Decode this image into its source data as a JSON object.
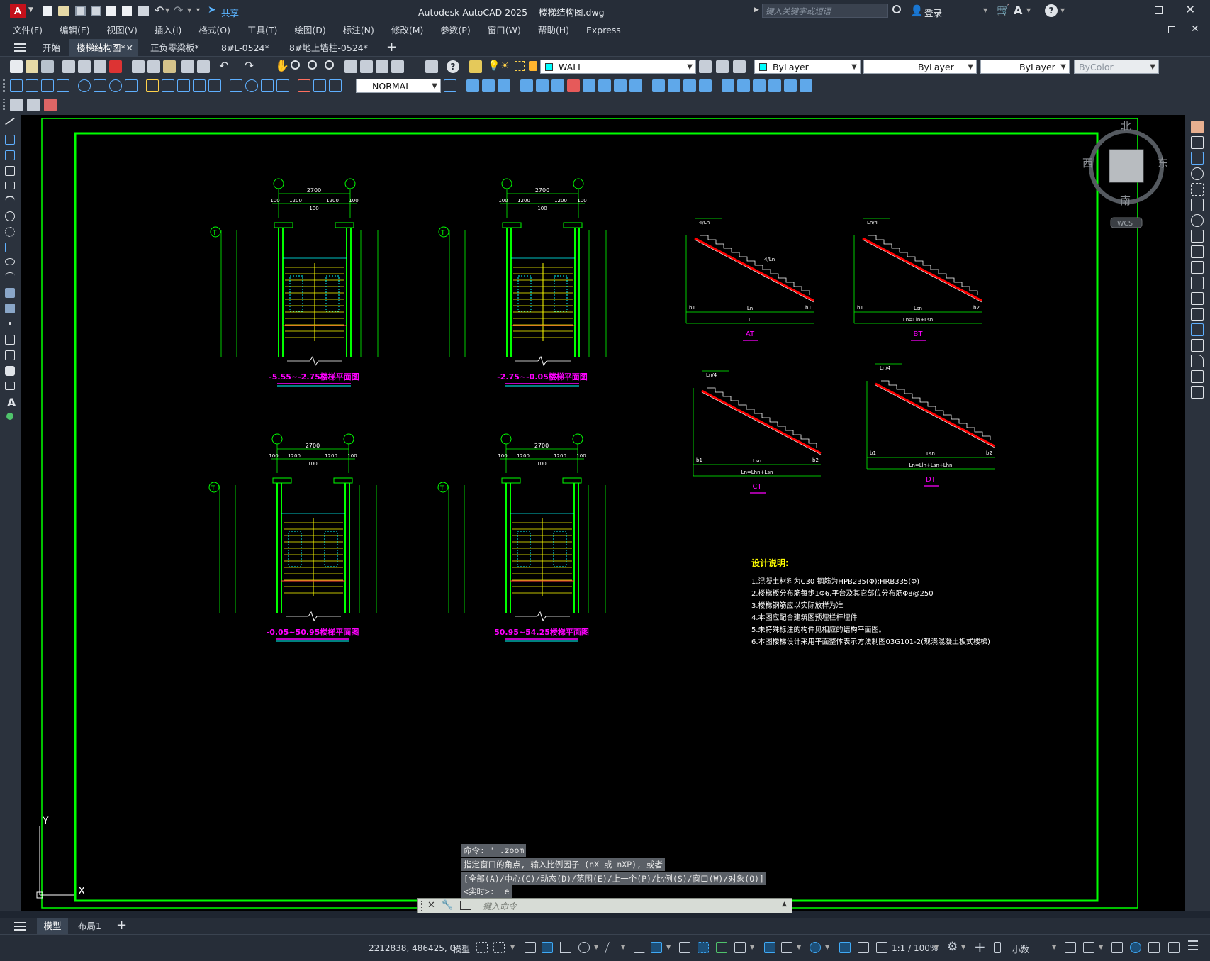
{
  "app": {
    "title": "Autodesk AutoCAD 2025    楼梯结构图.dwg",
    "share_label": "共享",
    "search_placeholder": "键入关键字或短语",
    "login_label": "登录"
  },
  "menu": [
    "文件(F)",
    "编辑(E)",
    "视图(V)",
    "插入(I)",
    "格式(O)",
    "工具(T)",
    "绘图(D)",
    "标注(N)",
    "修改(M)",
    "参数(P)",
    "窗口(W)",
    "帮助(H)",
    "Express"
  ],
  "file_tabs": [
    {
      "label": "开始"
    },
    {
      "label": "楼梯结构图*"
    },
    {
      "label": "正负零梁板*"
    },
    {
      "label": "8#L-0524*"
    },
    {
      "label": "8#地上墙柱-0524*"
    }
  ],
  "toolbar": {
    "layer_name": "WALL",
    "color": "ByLayer",
    "linetype": "ByLayer",
    "lineweight": "ByLayer",
    "plotstyle": "ByColor",
    "dimstyle": "NORMAL"
  },
  "viewcube": {
    "north": "北",
    "south": "南",
    "east": "东",
    "west": "西",
    "wcs": "WCS"
  },
  "ucs": {
    "y": "Y",
    "x": "X"
  },
  "drawing": {
    "plans": [
      {
        "title": "-5.55~-2.75楼梯平面图"
      },
      {
        "title": "-2.75~-0.05楼梯平面图"
      },
      {
        "title": "-0.05~50.95楼梯平面图"
      },
      {
        "title": "50.95~54.25楼梯平面图"
      }
    ],
    "plan_dims": {
      "total": "2700",
      "left": "1200",
      "right": "1200",
      "mid": "100",
      "edge": "100",
      "axis": "T"
    },
    "sections": [
      {
        "label": "AT",
        "top_a": "4/Ln",
        "top_b": "4/Ln",
        "bottom": "L",
        "bottom_inner": "Ln",
        "b1": "b1",
        "b2": "b1"
      },
      {
        "label": "BT",
        "top_a": "Ln/4",
        "bottom": "Ln=Lln+Lsn",
        "bottom_inner": "Lsn",
        "b1": "b1",
        "b2": "b2"
      },
      {
        "label": "CT",
        "top_a": "Ln/4",
        "bottom": "Ln=Lhn+Lsn",
        "bottom_inner": "Lsn",
        "b1": "b1",
        "b2": "b2"
      },
      {
        "label": "DT",
        "top_a": "Ln/4",
        "bottom": "Ln=Lln+Lsn+Lhn",
        "bottom_inner": "Lsn",
        "b1": "b1",
        "b2": "b2"
      }
    ],
    "notes_title": "设计说明:",
    "notes": [
      "1.混凝土材料为C30 钢筋为HPB235(Φ);HRB335(Φ)",
      "2.楼梯板分布筋每步1Φ6,平台及其它部位分布筋Φ8@250",
      "3.楼梯钢筋应以实际放样为准",
      "4.本图应配合建筑图预埋栏杆埋件",
      "5.未特殊标注的构件见相应的结构平面图。",
      "6.本图楼梯设计采用平面整体表示方法制图03G101-2(现浇混凝土板式楼梯)"
    ]
  },
  "command": {
    "history": [
      "命令: '_.zoom",
      "指定窗口的角点, 输入比例因子 (nX 或 nXP), 或者",
      "[全部(A)/中心(C)/动态(D)/范围(E)/上一个(P)/比例(S)/窗口(W)/对象(O)]",
      "<实时>: _e"
    ],
    "placeholder": "键入命令"
  },
  "layout_tabs": [
    "模型",
    "布局1"
  ],
  "status": {
    "coords": "2212838, 486425, 0",
    "mode": "模型",
    "scale": "1:1 / 100%",
    "units": "小数"
  },
  "colors": {
    "background": "#000000",
    "border_green": "#00ff00",
    "title_magenta": "#ff00ff",
    "rebar_red": "#ff0000",
    "stair_yellow": "#ffff00",
    "axis_cyan": "#00ffff"
  }
}
